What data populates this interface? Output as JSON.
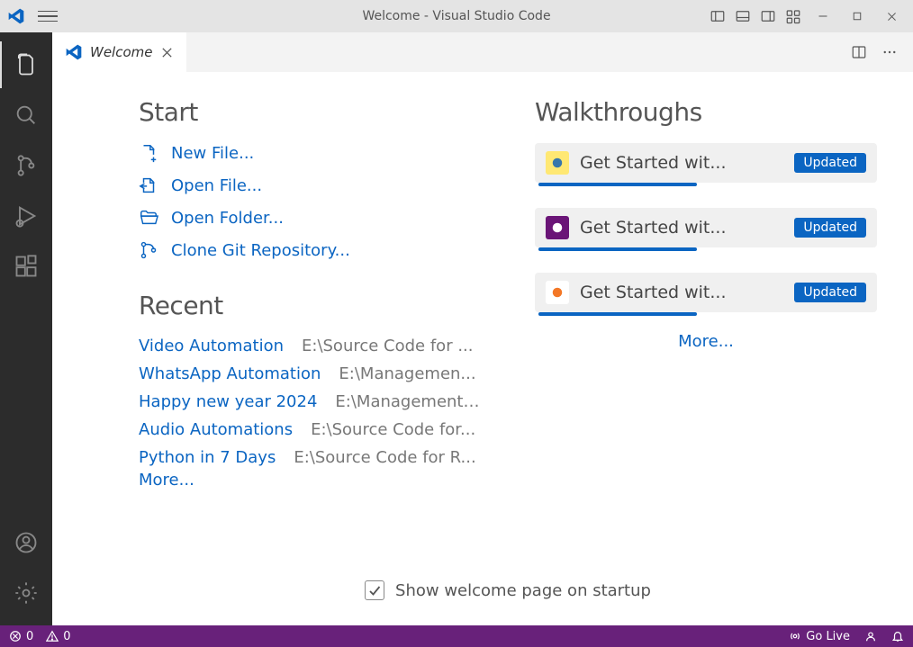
{
  "titlebar": {
    "title": "Welcome - Visual Studio Code"
  },
  "tab": {
    "label": "Welcome"
  },
  "start": {
    "heading": "Start",
    "items": [
      {
        "label": "New File..."
      },
      {
        "label": "Open File..."
      },
      {
        "label": "Open Folder..."
      },
      {
        "label": "Clone Git Repository..."
      }
    ]
  },
  "recent": {
    "heading": "Recent",
    "items": [
      {
        "name": "Video Automation",
        "path": "E:\\Source Code for ..."
      },
      {
        "name": "WhatsApp Automation",
        "path": "E:\\Managemen..."
      },
      {
        "name": "Happy new year 2024",
        "path": "E:\\Management ..."
      },
      {
        "name": "Audio Automations",
        "path": "E:\\Source Code for..."
      },
      {
        "name": "Python in 7 Days",
        "path": "E:\\Source Code for R..."
      }
    ],
    "more": "More..."
  },
  "walkthroughs": {
    "heading": "Walkthroughs",
    "items": [
      {
        "label": "Get Started wit...",
        "badge": "Updated",
        "icon": "python-icon",
        "bg": "#ffe873",
        "fg": "#3776ab"
      },
      {
        "label": "Get Started wit...",
        "badge": "Updated",
        "icon": "cpp-icon",
        "bg": "#6a1577",
        "fg": "#ffffff"
      },
      {
        "label": "Get Started wit...",
        "badge": "Updated",
        "icon": "jupyter-icon",
        "bg": "#ffffff",
        "fg": "#f37726"
      }
    ],
    "more": "More..."
  },
  "startup": {
    "label": "Show welcome page on startup",
    "checked": true
  },
  "statusbar": {
    "errors": "0",
    "warnings": "0",
    "golive": "Go Live"
  }
}
